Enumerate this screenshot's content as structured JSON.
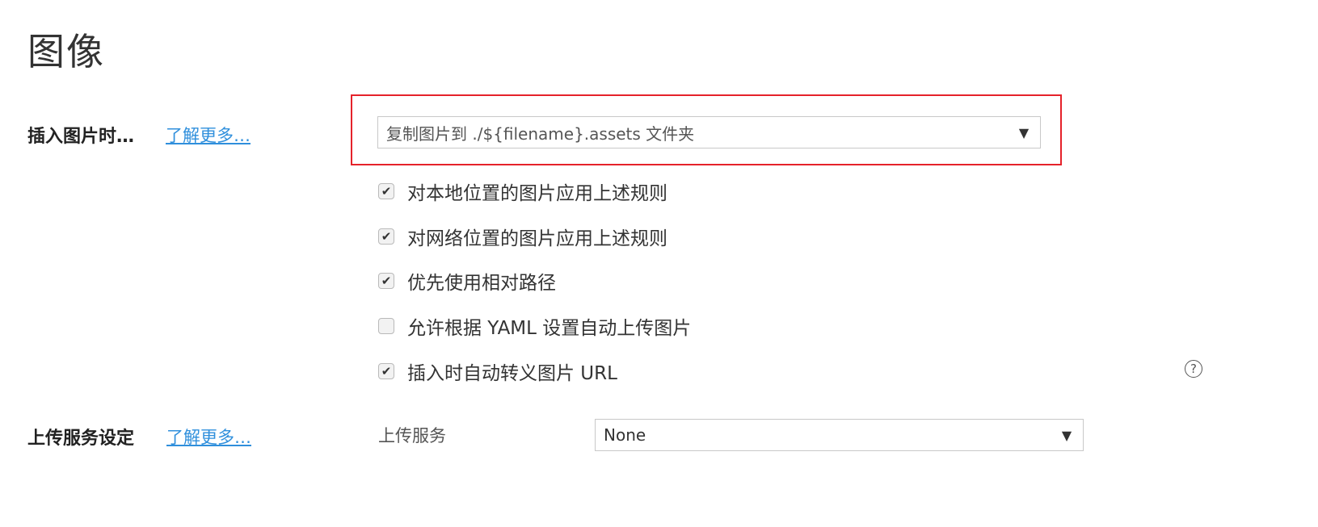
{
  "page": {
    "title": "图像"
  },
  "insert_image": {
    "label": "插入图片时…",
    "learn_more": "了解更多…",
    "select_value": "复制图片到 ./${filename}.assets 文件夹",
    "arrow": "▼",
    "options": [
      {
        "label": "对本地位置的图片应用上述规则",
        "checked": true
      },
      {
        "label": "对网络位置的图片应用上述规则",
        "checked": true
      },
      {
        "label": "优先使用相对路径",
        "checked": true
      },
      {
        "label": "允许根据 YAML 设置自动上传图片",
        "checked": false
      },
      {
        "label": "插入时自动转义图片 URL",
        "checked": true
      }
    ],
    "help_icon": "?"
  },
  "upload_service": {
    "label": "上传服务设定",
    "learn_more": "了解更多…",
    "field_label": "上传服务",
    "select_value": "None",
    "arrow": "▼"
  },
  "colors": {
    "highlight_border": "#e5222a",
    "link": "#2f8fdc"
  }
}
